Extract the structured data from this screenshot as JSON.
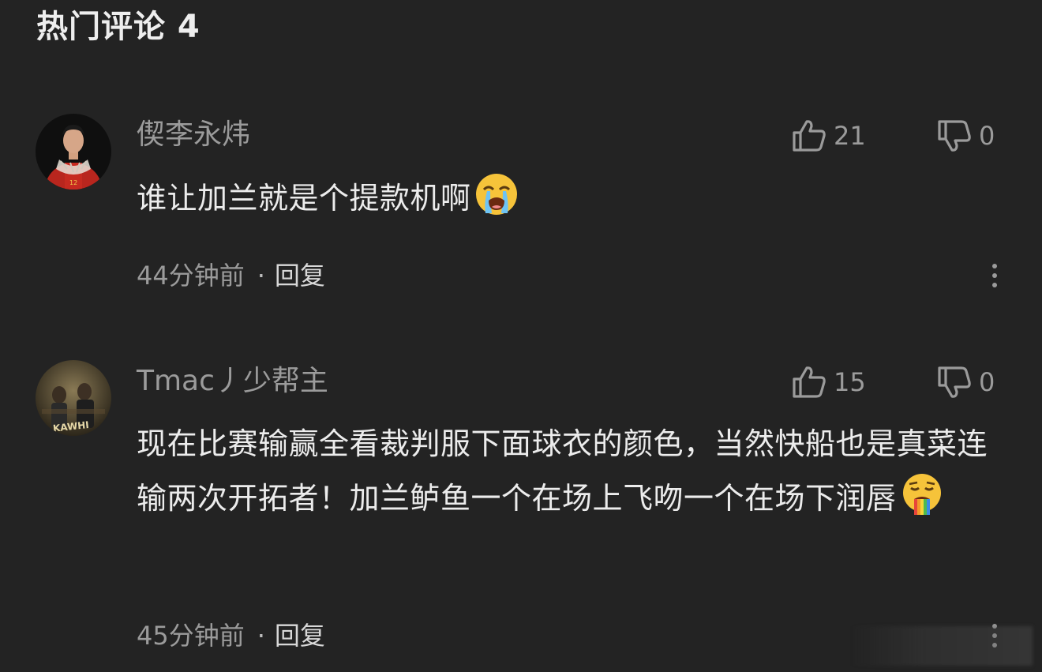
{
  "section": {
    "title": "热门评论 4"
  },
  "comments": [
    {
      "username": "偰李永炜",
      "text": "谁让加兰就是个提款机啊",
      "emoji": "loudly-crying-emoji",
      "likes": "21",
      "dislikes": "0",
      "time": "44分钟前",
      "separator": "·",
      "reply_label": "回复",
      "avatar_icon": "avatar-basketball-player"
    },
    {
      "username": "Tmac丿少帮主",
      "text": "现在比赛输赢全看裁判服下面球衣的颜色，当然快船也是真菜连输两次开拓者！加兰鲈鱼一个在场上飞吻一个在场下润唇",
      "emoji": "rainbow-vomit-emoji",
      "likes": "15",
      "dislikes": "0",
      "time": "45分钟前",
      "separator": "·",
      "reply_label": "回复",
      "avatar_icon": "avatar-kawhi"
    }
  ],
  "icons": {
    "like": "thumbs-up-icon",
    "dislike": "thumbs-down-icon",
    "more": "more-vertical-icon"
  },
  "colors": {
    "background": "#232323",
    "primary_text": "#ececec",
    "secondary_text": "#9b9b9b"
  }
}
